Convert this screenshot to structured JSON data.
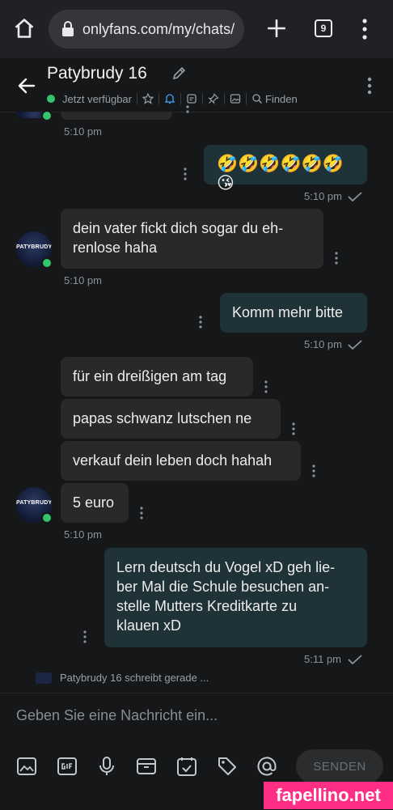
{
  "browser": {
    "url": "onlyfans.com/my/chats/",
    "tab_count": "9"
  },
  "chat": {
    "name": "Patybrudy 16",
    "status": "Jetzt verfügbar",
    "find_label": "Finden",
    "avatar_text": "PATYBRUDY16"
  },
  "messages": {
    "m0_time": "5:10 pm",
    "m1_text": "🤣🤣🤣🤣🤣🤣😘",
    "m1_time": "5:10 pm",
    "m2_text_line1": "dein vater fickt dich sogar du eh-",
    "m2_text_line2": "renlose haha",
    "m2_time": "5:10 pm",
    "m3_text": "Komm mehr bitte",
    "m3_time": "5:10 pm",
    "m4_text": "für ein dreißigen am tag",
    "m5_text": "papas schwanz lutschen ne",
    "m6_text": "verkauf dein leben doch hahah",
    "m7_text": "5 euro",
    "m7_time": "5:10 pm",
    "m8_line1": "Lern deutsch du Vogel xD geh lie-",
    "m8_line2": "ber Mal die Schule besuchen an-",
    "m8_line3": "stelle Mutters Kreditkarte zu",
    "m8_line4": "klauen xD",
    "m8_time": "5:11 pm"
  },
  "typing": "Patybrudy 16 schreibt gerade ...",
  "composer": {
    "placeholder": "Geben Sie eine Nachricht ein...",
    "send_label": "SENDEN"
  },
  "watermark": "fapellino.net",
  "colors": {
    "background": "#161718",
    "incoming_bubble": "#27292b",
    "outgoing_bubble": "#1e3238",
    "online": "#34c46b",
    "accent_bell": "#3ea6ff",
    "watermark": "#ff2f86"
  }
}
